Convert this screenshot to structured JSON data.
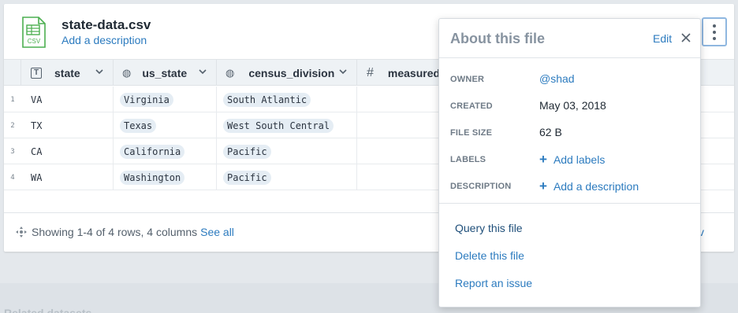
{
  "file": {
    "name": "state-data.csv",
    "add_description": "Add a description",
    "icon_label": "CSV",
    "icon": "csv-file-icon"
  },
  "table": {
    "columns": [
      {
        "name": "state",
        "type_icon": "text-type-icon",
        "glyph": "T"
      },
      {
        "name": "us_state",
        "type_icon": "geo-type-icon",
        "glyph": "◍"
      },
      {
        "name": "census_division",
        "type_icon": "geo-type-icon",
        "glyph": "◍"
      },
      {
        "name": "measured_",
        "type_icon": "number-type-icon",
        "glyph": "#"
      }
    ],
    "rows": [
      {
        "n": "1",
        "state": "VA",
        "us_state": "Virginia",
        "census_division": "South Atlantic"
      },
      {
        "n": "2",
        "state": "TX",
        "us_state": "Texas",
        "census_division": "West South Central"
      },
      {
        "n": "3",
        "state": "CA",
        "us_state": "California",
        "census_division": "Pacific"
      },
      {
        "n": "4",
        "state": "WA",
        "us_state": "Washington",
        "census_division": "Pacific"
      }
    ]
  },
  "footer": {
    "showing": "Showing 1-4 of 4 rows, 4 columns",
    "see_all": "See all",
    "peek": "v"
  },
  "popover": {
    "title": "About this file",
    "edit": "Edit",
    "meta": [
      {
        "key": "OWNER",
        "value": "@shad"
      },
      {
        "key": "CREATED",
        "value": "May 03, 2018"
      },
      {
        "key": "FILE SIZE",
        "value": "62 B"
      },
      {
        "key": "LABELS",
        "value": "Add labels"
      },
      {
        "key": "DESCRIPTION",
        "value": "Add a description"
      }
    ],
    "actions": [
      "Query this file",
      "Delete this file",
      "Report an issue"
    ]
  },
  "below_text": "Related datasets",
  "colors": {
    "accent": "#2c7bbf",
    "pill": "#e5edf4",
    "csv_green": "#4caf50"
  }
}
